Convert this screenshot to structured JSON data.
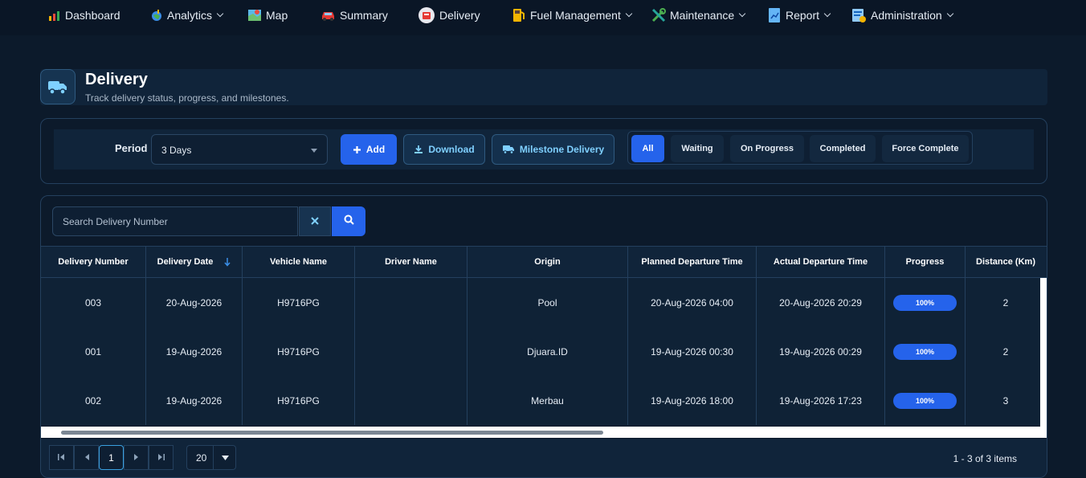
{
  "nav": {
    "items": [
      {
        "label": "Dashboard",
        "icon": "chart-bar-icon"
      },
      {
        "label": "Analytics",
        "icon": "globe-analytics-icon"
      },
      {
        "label": "Map",
        "icon": "map-icon"
      },
      {
        "label": "Summary",
        "icon": "car-icon"
      },
      {
        "label": "Delivery",
        "icon": "delivery-bag-icon"
      },
      {
        "label": "Fuel Management",
        "icon": "fuel-pump-icon"
      },
      {
        "label": "Maintenance",
        "icon": "tools-icon"
      },
      {
        "label": "Report",
        "icon": "report-icon"
      },
      {
        "label": "Administration",
        "icon": "admin-icon"
      }
    ]
  },
  "header": {
    "title": "Delivery",
    "subtitle": "Track delivery status, progress, and milestones."
  },
  "filter": {
    "period_label": "Period",
    "period_value": "3 Days",
    "add_label": "Add",
    "download_label": "Download",
    "milestone_label": "Milestone Delivery",
    "tabs": [
      "All",
      "Waiting",
      "On Progress",
      "Completed",
      "Force Complete"
    ],
    "active_tab": "All"
  },
  "search": {
    "placeholder": "Search Delivery Number"
  },
  "table": {
    "columns": [
      "Delivery Number",
      "Delivery Date",
      "Vehicle Name",
      "Driver Name",
      "Origin",
      "Planned Departure Time",
      "Actual Departure Time",
      "Progress",
      "Distance (Km)"
    ],
    "sorted_column": "Delivery Date",
    "rows": [
      {
        "delivery_number": "003",
        "delivery_date": "20-Aug-2026",
        "vehicle": "H9716PG",
        "driver": "",
        "origin": "Pool",
        "planned": "20-Aug-2026 04:00",
        "actual": "20-Aug-2026 20:29",
        "progress": "100%",
        "distance": "2"
      },
      {
        "delivery_number": "001",
        "delivery_date": "19-Aug-2026",
        "vehicle": "H9716PG",
        "driver": "",
        "origin": "Djuara.ID",
        "planned": "19-Aug-2026 00:30",
        "actual": "19-Aug-2026 00:29",
        "progress": "100%",
        "distance": "2"
      },
      {
        "delivery_number": "002",
        "delivery_date": "19-Aug-2026",
        "vehicle": "H9716PG",
        "driver": "",
        "origin": "Merbau",
        "planned": "19-Aug-2026 18:00",
        "actual": "19-Aug-2026 17:23",
        "progress": "100%",
        "distance": "3"
      }
    ]
  },
  "pager": {
    "current_page": "1",
    "page_size": "20",
    "info": "1 - 3 of 3 items"
  },
  "colors": {
    "accent": "#2563eb",
    "background": "#0c1a2b",
    "panel": "#10243a"
  }
}
